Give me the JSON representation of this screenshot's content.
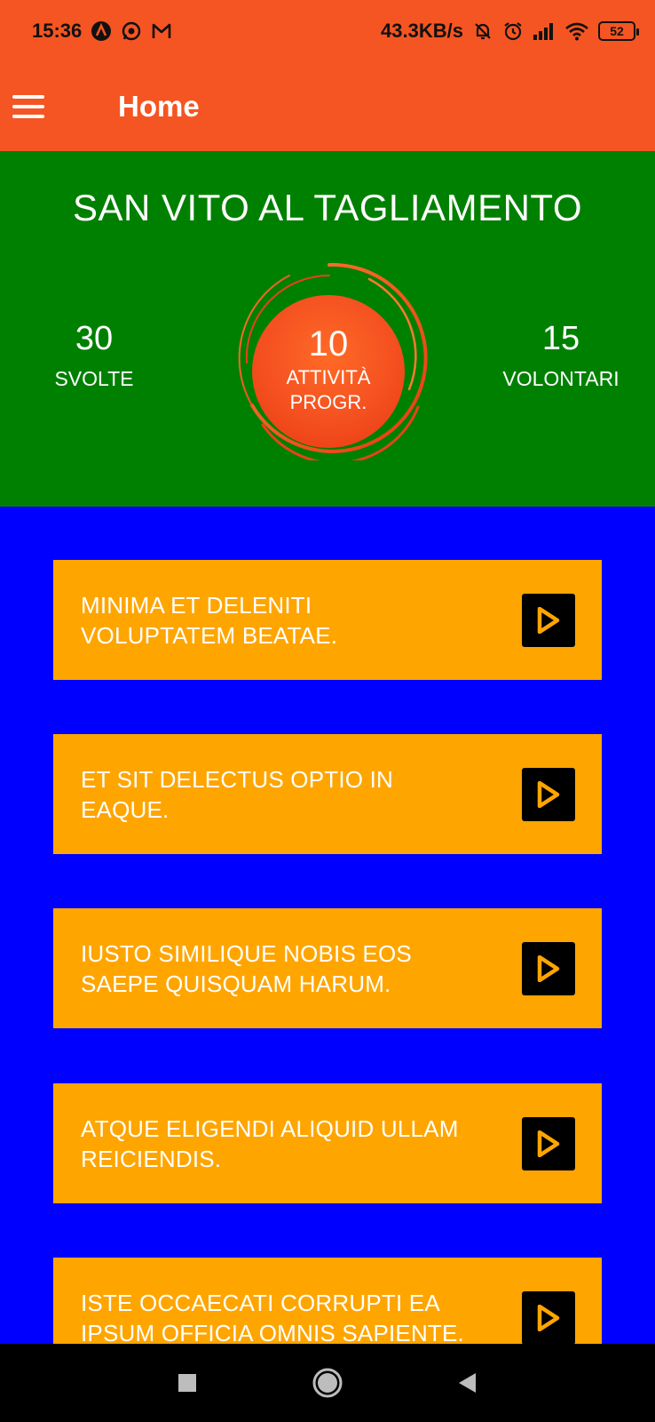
{
  "status_bar": {
    "time": "15:36",
    "network_speed": "43.3KB/s",
    "battery": "52",
    "icons": [
      "app-a-icon",
      "whatsapp-icon",
      "gmail-icon",
      "muted-bell-icon",
      "alarm-icon",
      "signal-icon",
      "wifi-icon",
      "battery-icon"
    ]
  },
  "app_bar": {
    "title": "Home",
    "menu_icon": "hamburger-menu-icon"
  },
  "stats": {
    "town": "SAN VITO AL TAGLIAMENTO",
    "done": {
      "value": "30",
      "label": "SVOLTE"
    },
    "in_progress": {
      "value": "10",
      "label_line1": "ATTIVITÀ",
      "label_line2": "PROGR."
    },
    "volunteers": {
      "value": "15",
      "label": "VOLONTARI"
    }
  },
  "activities": [
    {
      "line1": "MINIMA ET DELENITI",
      "line2": "VOLUPTATEM BEATAE."
    },
    {
      "line1": "ET SIT DELECTUS OPTIO IN",
      "line2": "EAQUE."
    },
    {
      "line1": "IUSTO SIMILIQUE NOBIS EOS",
      "line2": "SAEPE QUISQUAM HARUM."
    },
    {
      "line1": "ATQUE ELIGENDI ALIQUID ULLAM",
      "line2": "REICIENDIS."
    },
    {
      "line1": "ISTE OCCAECATI CORRUPTI EA",
      "line2": "IPSUM OFFICIA OMNIS SAPIENTE."
    }
  ],
  "colors": {
    "primary": "#F55522",
    "stats_bg": "#008000",
    "list_bg": "#0000FF",
    "card_bg": "#FFA500",
    "play_icon": "#FFA500"
  },
  "nav": [
    "recents-square-icon",
    "home-circle-icon",
    "back-triangle-icon"
  ]
}
